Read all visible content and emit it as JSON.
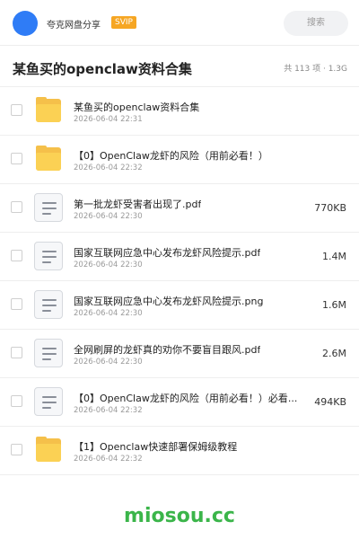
{
  "header": {
    "share_name": "夸克网盘分享",
    "badge": "SVIP",
    "search_placeholder": "搜索"
  },
  "folder": {
    "title": "某鱼买的openclaw资料合集",
    "summary": "共 113 项 · 1.3G"
  },
  "items": [
    {
      "type": "folder",
      "name": "某鱼买的openclaw资料合集",
      "date": "2026-06-04 22:31",
      "size": ""
    },
    {
      "type": "folder",
      "name": "【0】OpenClaw龙虾的风险（用前必看！）",
      "date": "2026-06-04 22:32",
      "size": ""
    },
    {
      "type": "file",
      "name": "第一批龙虾受害者出现了.pdf",
      "date": "2026-06-04 22:30",
      "size": "770KB"
    },
    {
      "type": "file",
      "name": "国家互联网应急中心发布龙虾风险提示.pdf",
      "date": "2026-06-04 22:30",
      "size": "1.4M"
    },
    {
      "type": "file",
      "name": "国家互联网应急中心发布龙虾风险提示.png",
      "date": "2026-06-04 22:30",
      "size": "1.6M"
    },
    {
      "type": "file",
      "name": "全网刷屏的龙虾真的劝你不要盲目跟风.pdf",
      "date": "2026-06-04 22:30",
      "size": "2.6M"
    },
    {
      "type": "file",
      "name": "【0】OpenClaw龙虾的风险（用前必看！）必看...",
      "date": "2026-06-04 22:32",
      "size": "494KB"
    },
    {
      "type": "folder",
      "name": "【1】Openclaw快速部署保姆级教程",
      "date": "2026-06-04 22:32",
      "size": ""
    }
  ],
  "watermark": "miosou.cc",
  "colors": {
    "accent": "#2f7cf6",
    "badge": "#f6a623",
    "folder": "#fbd154",
    "watermark": "#3bb54a"
  }
}
